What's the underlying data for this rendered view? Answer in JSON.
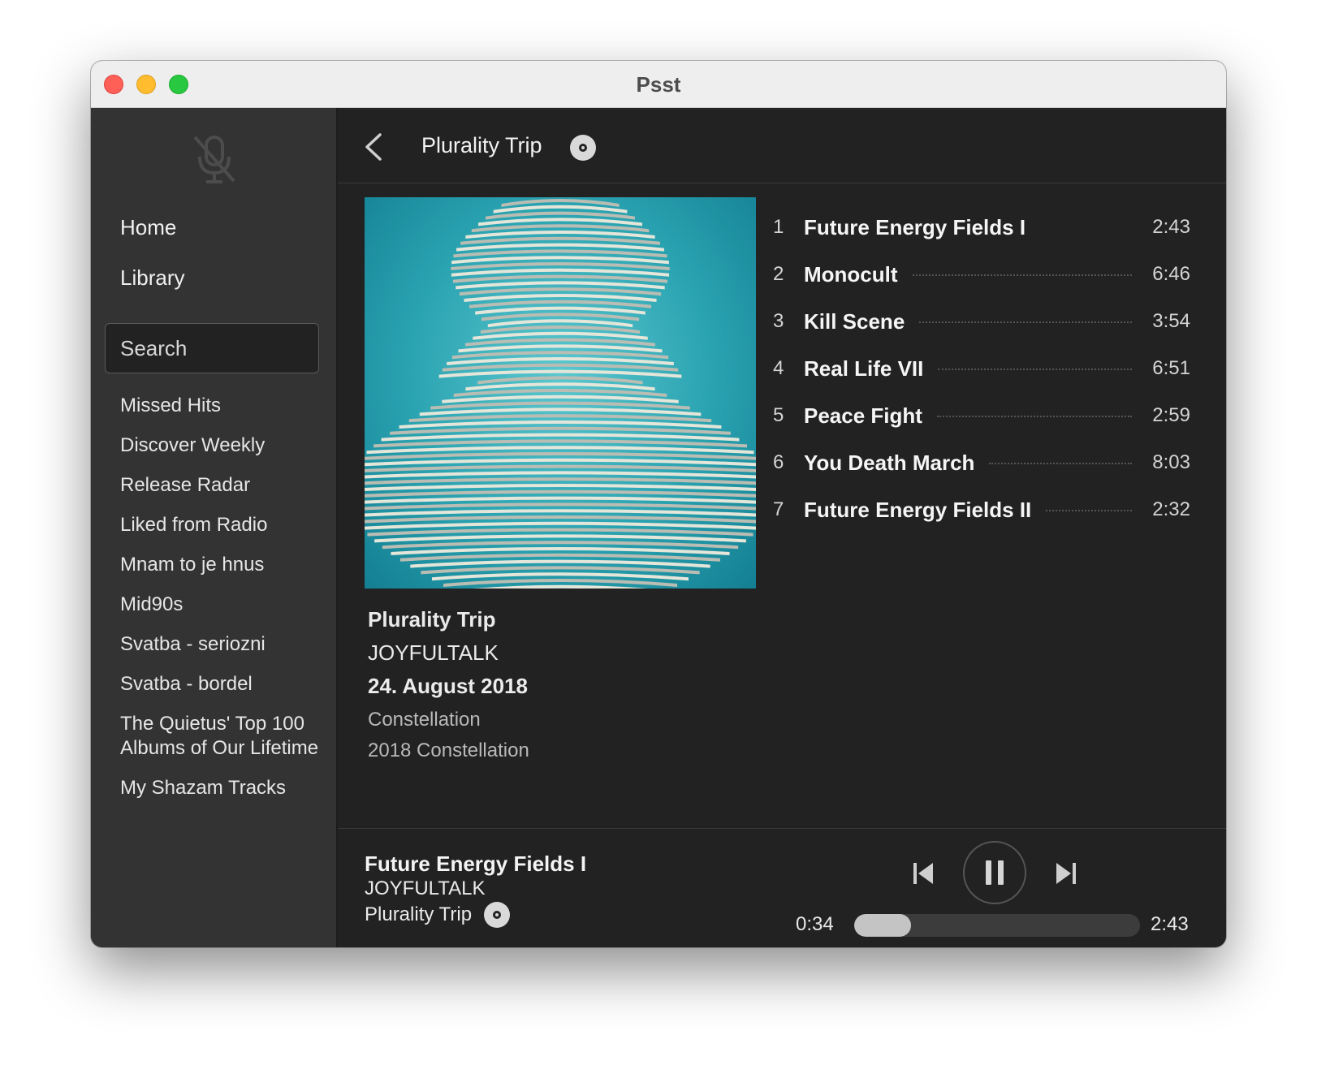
{
  "window": {
    "title": "Psst"
  },
  "sidebar": {
    "home_label": "Home",
    "library_label": "Library",
    "search_placeholder": "Search",
    "playlists": [
      "Missed Hits",
      "Discover Weekly",
      "Release Radar",
      "Liked from Radio",
      "Mnam to je hnus",
      "Mid90s",
      "Svatba - seriozni",
      "Svatba - bordel",
      "The Quietus' Top 100 Albums of Our Lifetime",
      "My Shazam Tracks"
    ]
  },
  "header": {
    "title": "Plurality Trip"
  },
  "album": {
    "title": "Plurality Trip",
    "artist": "JOYFULTALK",
    "release_date": "24. August 2018",
    "label": "Constellation",
    "copyright": "2018 Constellation"
  },
  "tracks": [
    {
      "number": "1",
      "title": "Future Energy Fields I",
      "duration": "2:43"
    },
    {
      "number": "2",
      "title": "Monocult",
      "duration": "6:46"
    },
    {
      "number": "3",
      "title": "Kill Scene",
      "duration": "3:54"
    },
    {
      "number": "4",
      "title": "Real Life VII",
      "duration": "6:51"
    },
    {
      "number": "5",
      "title": "Peace Fight",
      "duration": "2:59"
    },
    {
      "number": "6",
      "title": "You Death March",
      "duration": "8:03"
    },
    {
      "number": "7",
      "title": "Future Energy Fields II",
      "duration": "2:32"
    }
  ],
  "now_playing": {
    "title": "Future Energy Fields I",
    "artist": "JOYFULTALK",
    "album": "Plurality Trip",
    "elapsed": "0:34",
    "total": "2:43",
    "progress": 0.2,
    "state": "playing"
  },
  "icons": {
    "sidebar_top": "microphone-slash-icon",
    "back": "chevron-left-icon",
    "album": "disc-icon",
    "prev": "skip-previous-icon",
    "pause": "pause-icon",
    "next": "skip-next-icon"
  },
  "colors": {
    "background": "#222222",
    "sidebar": "#333333",
    "text": "#f0f0f0",
    "muted_text": "#b9b9b9",
    "progress_fill": "#c4c4c4",
    "progress_track": "#3c3c3c"
  }
}
